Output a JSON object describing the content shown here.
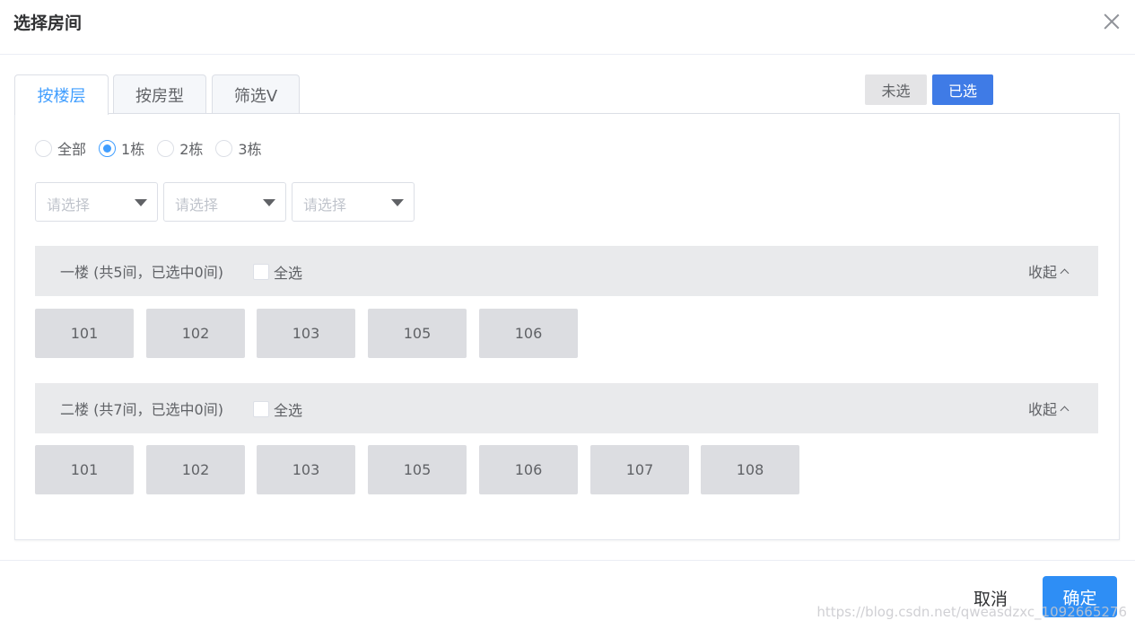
{
  "dialog": {
    "title": "选择房间"
  },
  "tabs": [
    {
      "label": "按楼层"
    },
    {
      "label": "按房型"
    },
    {
      "label": "筛选V"
    }
  ],
  "selection_toggle": {
    "unselected_label": "未选",
    "selected_label": "已选"
  },
  "building_filter": {
    "options": [
      "全部",
      "1栋",
      "2栋",
      "3栋"
    ],
    "selected": "1栋"
  },
  "selects": [
    {
      "placeholder": "请选择"
    },
    {
      "placeholder": "请选择"
    },
    {
      "placeholder": "请选择"
    }
  ],
  "floors": [
    {
      "title": "一楼 (共5间，已选中0间)",
      "select_all_label": "全选",
      "collapse_label": "收起",
      "rooms": [
        "101",
        "102",
        "103",
        "105",
        "106"
      ]
    },
    {
      "title": "二楼 (共7间，已选中0间)",
      "select_all_label": "全选",
      "collapse_label": "收起",
      "rooms": [
        "101",
        "102",
        "103",
        "105",
        "106",
        "107",
        "108"
      ]
    }
  ],
  "footer": {
    "cancel_label": "取消",
    "confirm_label": "确定"
  },
  "watermark": "https://blog.csdn.net/qweasdzxc_1092665276",
  "colors": {
    "accent": "#409eff",
    "selected_button": "#3f7be6",
    "confirm_button": "#2e8ef5"
  }
}
